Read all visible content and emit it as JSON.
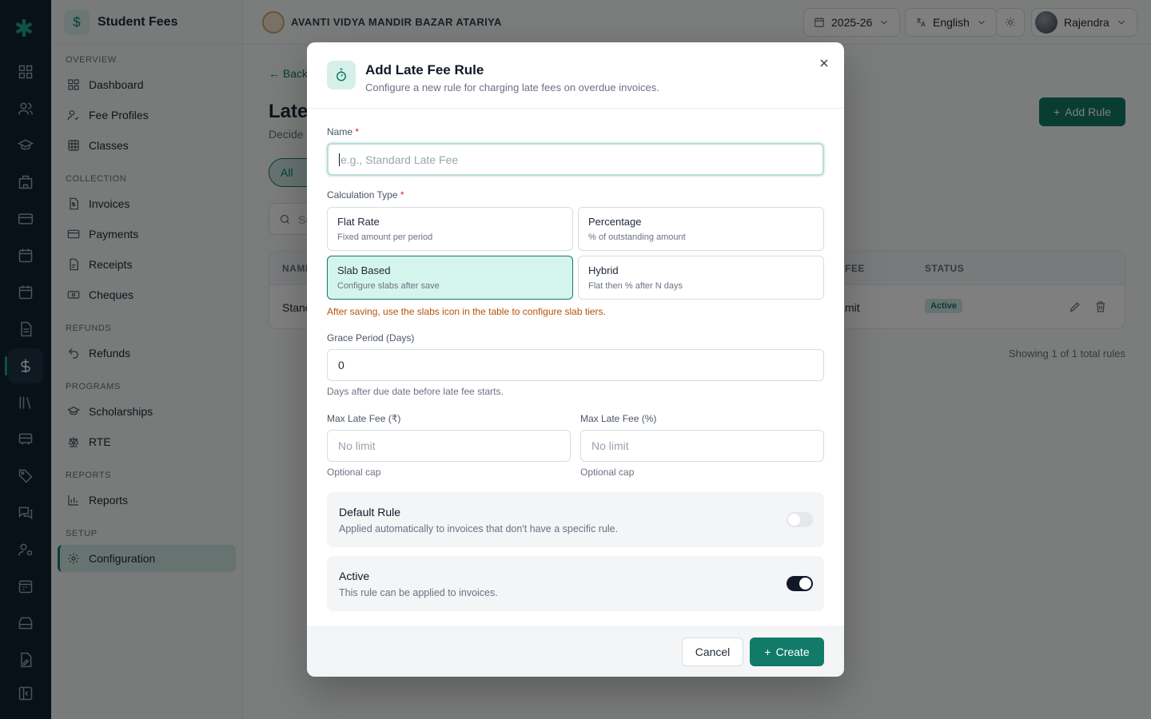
{
  "app": {
    "module_title": "Student Fees",
    "school_name": "AVANTI VIDYA MANDIR BAZAR ATARIYA"
  },
  "topbar": {
    "session": "2025-26",
    "language": "English",
    "user": "Rajendra"
  },
  "sidebar": {
    "sections": {
      "overview": "OVERVIEW",
      "collection": "COLLECTION",
      "refunds": "REFUNDS",
      "programs": "PROGRAMS",
      "reports": "REPORTS",
      "setup": "SETUP"
    },
    "items": {
      "dashboard": "Dashboard",
      "fee_profiles": "Fee Profiles",
      "classes": "Classes",
      "invoices": "Invoices",
      "payments": "Payments",
      "receipts": "Receipts",
      "cheques": "Cheques",
      "refunds": "Refunds",
      "scholarships": "Scholarships",
      "rte": "RTE",
      "reports": "Reports",
      "configuration": "Configuration"
    },
    "active": "configuration"
  },
  "page": {
    "back": "← Back",
    "title": "Late",
    "subtitle": "Decide",
    "add_rule": "Add Rule",
    "filter_all": "All",
    "search_placeholder": "Se",
    "table": {
      "col_name": "NAME",
      "col_fee": "FEE",
      "col_status": "STATUS",
      "row_name": "Stand",
      "row_fee": "mit",
      "row_status": "Active"
    },
    "showing": "Showing 1 of 1 total rules"
  },
  "modal": {
    "title": "Add Late Fee Rule",
    "description": "Configure a new rule for charging late fees on overdue invoices.",
    "name_label": "Name",
    "name_placeholder": "e.g., Standard Late Fee",
    "required_mark": "*",
    "calc_label": "Calculation Type",
    "options": [
      {
        "title": "Flat Rate",
        "desc": "Fixed amount per period",
        "selected": false
      },
      {
        "title": "Percentage",
        "desc": "% of outstanding amount",
        "selected": false
      },
      {
        "title": "Slab Based",
        "desc": "Configure slabs after save",
        "selected": true
      },
      {
        "title": "Hybrid",
        "desc": "Flat then % after N days",
        "selected": false
      }
    ],
    "slab_warning": "After saving, use the slabs icon in the table to configure slab tiers.",
    "grace_label": "Grace Period (Days)",
    "grace_value": "0",
    "grace_help": "Days after due date before late fee starts.",
    "max_amount_label": "Max Late Fee (₹)",
    "max_amount_placeholder": "No limit",
    "max_amount_help": "Optional cap",
    "max_pct_label": "Max Late Fee (%)",
    "max_pct_placeholder": "No limit",
    "max_pct_help": "Optional cap",
    "default_rule": {
      "title": "Default Rule",
      "desc": "Applied automatically to invoices that don't have a specific rule.",
      "on": false
    },
    "active_rule": {
      "title": "Active",
      "desc": "This rule can be applied to invoices.",
      "on": true
    },
    "cancel": "Cancel",
    "create": "Create"
  },
  "colors": {
    "brand": "#127a68",
    "rail": "#132230",
    "warning": "#b45309",
    "selected_bg": "#d4f5ec"
  }
}
